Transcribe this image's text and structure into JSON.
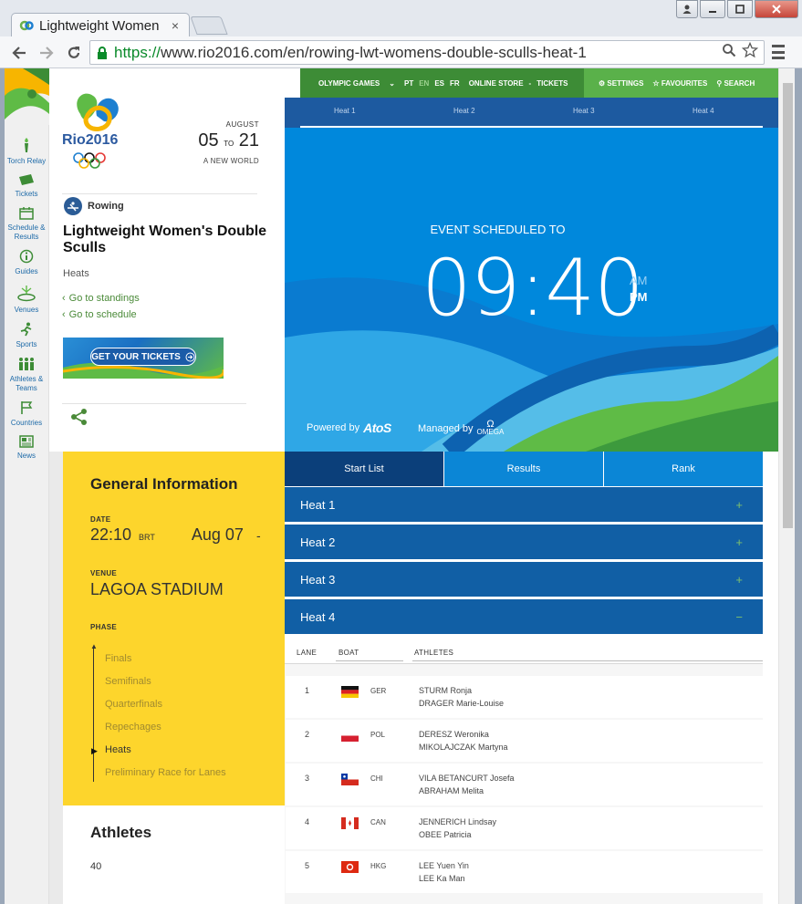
{
  "browser": {
    "tab_title": "Lightweight Women",
    "tab_close": "×",
    "url_scheme": "https://",
    "url_rest": "www.rio2016.com/en/rowing-lwt-womens-double-sculls-heat-1"
  },
  "sidebar": [
    {
      "label": "Torch Relay",
      "icon": "torch-icon"
    },
    {
      "label": "Tickets",
      "icon": "ticket-icon"
    },
    {
      "label": "Schedule & Results",
      "icon": "calendar-icon"
    },
    {
      "label": "Guides",
      "icon": "info-icon"
    },
    {
      "label": "Venues",
      "icon": "venue-icon"
    },
    {
      "label": "Sports",
      "icon": "runner-icon"
    },
    {
      "label": "Athletes & Teams",
      "icon": "athletes-icon"
    },
    {
      "label": "Countries",
      "icon": "flag-icon"
    },
    {
      "label": "News",
      "icon": "news-icon"
    }
  ],
  "header": {
    "month": "AUGUST",
    "date_from": "05",
    "date_to_word": "TO",
    "date_to": "21",
    "tagline": "A NEW WORLD",
    "sport": "Rowing",
    "event_title": "Lightweight Women's Double Sculls",
    "event_phase": "Heats",
    "link_standings": "Go to standings",
    "link_schedule": "Go to schedule",
    "tickets_button": "GET YOUR TICKETS"
  },
  "topnav": {
    "olympic_games": "OLYMPIC GAMES",
    "lang_pt": "PT",
    "lang_en": "EN",
    "lang_es": "ES",
    "lang_fr": "FR",
    "store": "ONLINE STORE",
    "dash": "-",
    "tickets": "TICKETS",
    "settings": "SETTINGS",
    "favourites": "FAVOURITES",
    "search": "SEARCH"
  },
  "heat_tabs": [
    "Heat 1",
    "Heat 2",
    "Heat 3",
    "Heat 4"
  ],
  "hero": {
    "scheduled_label": "EVENT SCHEDULED TO",
    "time": "09:40",
    "am": "AM",
    "pm": "PM",
    "powered_by": "Powered by",
    "atos": "AtoS",
    "managed_by": "Managed by",
    "omega": "OMEGA"
  },
  "general": {
    "title": "General Information",
    "date_label": "DATE",
    "time": "22:10",
    "tz": "BRT",
    "date": "Aug 07",
    "date_dash": "-",
    "venue_label": "VENUE",
    "venue": "LAGOA STADIUM",
    "phase_label": "PHASE",
    "phases": [
      "Finals",
      "Semifinals",
      "Quarterfinals",
      "Repechages",
      "Heats",
      "Preliminary Race for Lanes"
    ],
    "current_phase": "Heats"
  },
  "athletes": {
    "title": "Athletes",
    "count": "40"
  },
  "result_tabs": [
    "Start List",
    "Results",
    "Rank"
  ],
  "heats": [
    {
      "label": "Heat 1",
      "toggle": "+"
    },
    {
      "label": "Heat 2",
      "toggle": "+"
    },
    {
      "label": "Heat 3",
      "toggle": "+"
    },
    {
      "label": "Heat 4",
      "toggle": "−"
    }
  ],
  "startlist": {
    "headers": {
      "lane": "LANE",
      "boat": "BOAT",
      "athletes": "ATHLETES"
    },
    "rows": [
      {
        "lane": "1",
        "country": "GER",
        "athlete1": "STURM Ronja",
        "athlete2": "DRAGER Marie-Louise"
      },
      {
        "lane": "2",
        "country": "POL",
        "athlete1": "DERESZ Weronika",
        "athlete2": "MIKOLAJCZAK Martyna"
      },
      {
        "lane": "3",
        "country": "CHI",
        "athlete1": "VILA BETANCURT Josefa",
        "athlete2": "ABRAHAM Melita"
      },
      {
        "lane": "4",
        "country": "CAN",
        "athlete1": "JENNERICH Lindsay",
        "athlete2": "OBEE Patricia"
      },
      {
        "lane": "5",
        "country": "HKG",
        "athlete1": "LEE Yuen Yin",
        "athlete2": "LEE Ka Man"
      }
    ]
  },
  "colors": {
    "brand_green": "#3d8c36",
    "brand_blue": "#0088dc",
    "info_yellow": "#fdd52c",
    "heat_bar": "#115fa5"
  }
}
